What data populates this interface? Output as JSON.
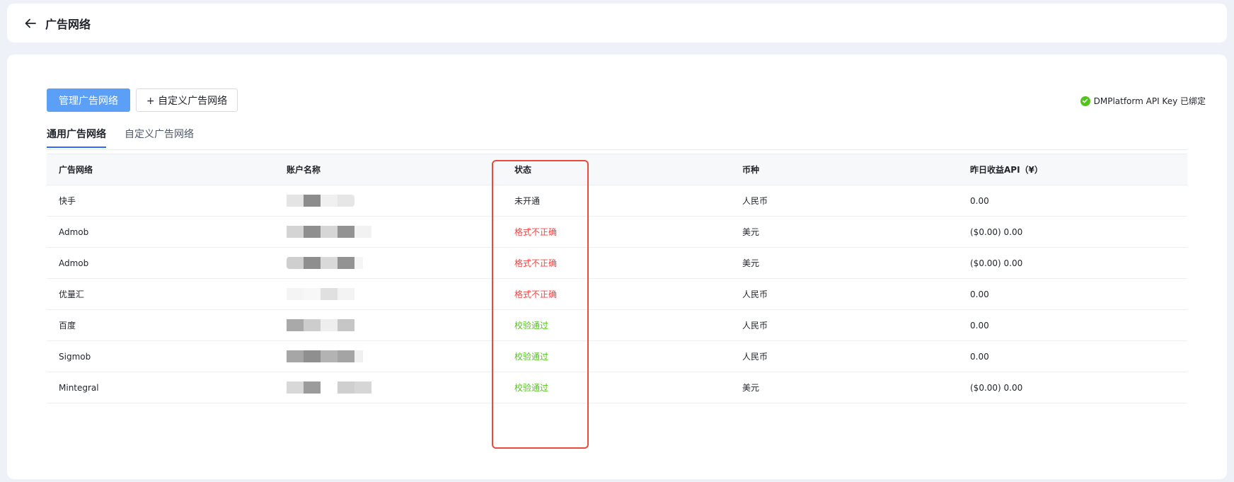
{
  "header": {
    "title": "广告网络"
  },
  "toolbar": {
    "manage_label": "管理广告网络",
    "custom_label": "+ 自定义广告网络",
    "key_status": "DMPlatform API Key 已绑定"
  },
  "tabs": [
    {
      "label": "通用广告网络",
      "active": true
    },
    {
      "label": "自定义广告网络",
      "active": false
    }
  ],
  "table": {
    "columns": [
      "广告网络",
      "账户名称",
      "状态",
      "币种",
      "昨日收益API（¥）"
    ],
    "rows": [
      {
        "network": "快手",
        "status": "未开通",
        "status_type": "pending",
        "currency": "人民币",
        "revenue": "0.00"
      },
      {
        "network": "Admob",
        "status": "格式不正确",
        "status_type": "error",
        "currency": "美元",
        "revenue": "($0.00) 0.00"
      },
      {
        "network": "Admob",
        "status": "格式不正确",
        "status_type": "error",
        "currency": "美元",
        "revenue": "($0.00) 0.00"
      },
      {
        "network": "优量汇",
        "status": "格式不正确",
        "status_type": "error",
        "currency": "人民币",
        "revenue": "0.00"
      },
      {
        "network": "百度",
        "status": "校验通过",
        "status_type": "ok",
        "currency": "人民币",
        "revenue": "0.00"
      },
      {
        "network": "Sigmob",
        "status": "校验通过",
        "status_type": "ok",
        "currency": "人民币",
        "revenue": "0.00"
      },
      {
        "network": "Mintegral",
        "status": "校验通过",
        "status_type": "ok",
        "currency": "美元",
        "revenue": "($0.00) 0.00"
      }
    ]
  },
  "colors": {
    "primary": "#5b9ff7",
    "error": "#f53f3f",
    "success": "#52c41a",
    "highlight": "#e94a3c"
  }
}
